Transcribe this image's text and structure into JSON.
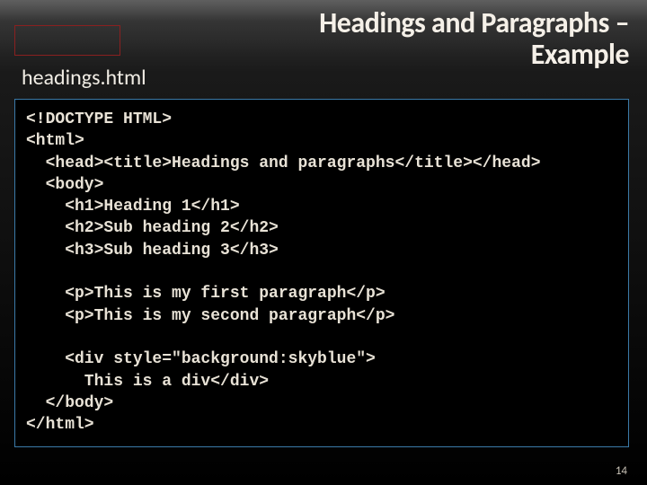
{
  "title_line1": "Headings and Paragraphs –",
  "title_line2": "Example",
  "filename": "headings.html",
  "code": "<!DOCTYPE HTML>\n<html>\n  <head><title>Headings and paragraphs</title></head>\n  <body>\n    <h1>Heading 1</h1>\n    <h2>Sub heading 2</h2>\n    <h3>Sub heading 3</h3>\n\n    <p>This is my first paragraph</p>\n    <p>This is my second paragraph</p>\n\n    <div style=\"background:skyblue\">\n      This is a div</div>\n  </body>\n</html>",
  "page_number": "14"
}
